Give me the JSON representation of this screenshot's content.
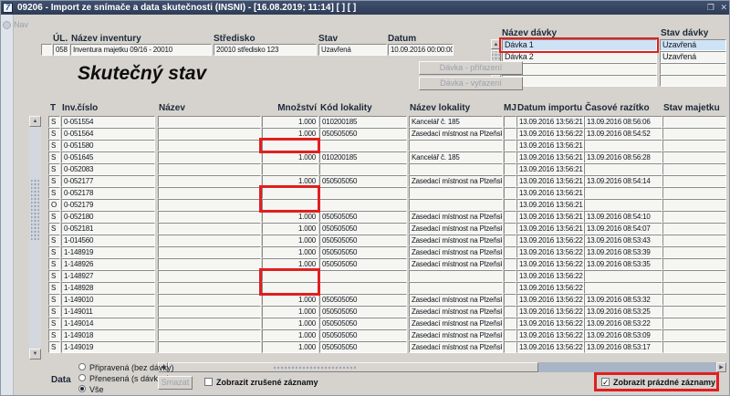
{
  "window": {
    "title": "09206 - Import ze snímače a data skutečnosti (INSNI) - [16.08.2019; 11:14]  [ ]  [ ]",
    "icon_glyph": "7",
    "controls": {
      "restore": "❐",
      "close": "✕"
    }
  },
  "nav": {
    "label": "Nav"
  },
  "header": {
    "ul_label": "ÚL.",
    "ul_value": "058",
    "nazev_label": "Název inventury",
    "nazev_value": "Inventura majetku 09/16 - 20010",
    "stredisko_label": "Středisko",
    "stredisko_value": "20010 středisko 123",
    "stav_label": "Stav",
    "stav_value": "Uzavřená",
    "datum_label": "Datum",
    "datum_value": "10.09.2016 00:00:00"
  },
  "batch_panel": {
    "name_label": "Název dávky",
    "status_label": "Stav dávky",
    "rows": [
      {
        "name": "Dávka 1",
        "status": "Uzavřená",
        "selected": true,
        "annotated": true
      },
      {
        "name": "Dávka 2",
        "status": "Uzavřená",
        "selected": false,
        "annotated": false
      },
      {
        "name": "",
        "status": "",
        "selected": false,
        "annotated": false
      },
      {
        "name": "",
        "status": "",
        "selected": false,
        "annotated": false
      }
    ]
  },
  "actions": {
    "assign": "Dávka - přiřazení",
    "remove": "Dávka - vyřazení",
    "delete": "Smazat"
  },
  "section_title": "Skutečný stav",
  "table": {
    "columns": [
      "T",
      "Inv.číslo",
      "Název",
      "Množství",
      "Kód lokality",
      "Název lokality",
      "MJ",
      "Datum importu",
      "Časové razítko",
      "Stav majetku"
    ],
    "rows": [
      {
        "t": "S",
        "inv": "0-051554",
        "nazev": "",
        "mnozstvi": "1.000",
        "kod": "010200185",
        "lokalita": "Kancelář č. 185",
        "mj": "",
        "import": "13.09.2016 13:56:21",
        "razitko": "13.09.2016 08:56:06",
        "stav": ""
      },
      {
        "t": "S",
        "inv": "0-051564",
        "nazev": "",
        "mnozstvi": "1.000",
        "kod": "050505050",
        "lokalita": "Zasedací místnost na Plzeňské",
        "mj": "",
        "import": "13.09.2016 13:56:22",
        "razitko": "13.09.2016 08:54:52",
        "stav": ""
      },
      {
        "t": "S",
        "inv": "0-051580",
        "nazev": "",
        "mnozstvi": "",
        "kod": "",
        "lokalita": "",
        "mj": "",
        "import": "13.09.2016 13:56:21",
        "razitko": "",
        "stav": ""
      },
      {
        "t": "S",
        "inv": "0-051645",
        "nazev": "",
        "mnozstvi": "1.000",
        "kod": "010200185",
        "lokalita": "Kancelář č. 185",
        "mj": "",
        "import": "13.09.2016 13:56:21",
        "razitko": "13.09.2016 08:56:28",
        "stav": ""
      },
      {
        "t": "S",
        "inv": "0-052083",
        "nazev": "",
        "mnozstvi": "",
        "kod": "",
        "lokalita": "",
        "mj": "",
        "import": "13.09.2016 13:56:21",
        "razitko": "",
        "stav": ""
      },
      {
        "t": "S",
        "inv": "0-052177",
        "nazev": "",
        "mnozstvi": "1.000",
        "kod": "050505050",
        "lokalita": "Zasedací místnost na Plzeňské",
        "mj": "",
        "import": "13.09.2016 13:56:21",
        "razitko": "13.09.2016 08:54:14",
        "stav": ""
      },
      {
        "t": "S",
        "inv": "0-052178",
        "nazev": "",
        "mnozstvi": "",
        "kod": "",
        "lokalita": "",
        "mj": "",
        "import": "13.09.2016 13:56:21",
        "razitko": "",
        "stav": ""
      },
      {
        "t": "O",
        "inv": "0-052179",
        "nazev": "",
        "mnozstvi": "",
        "kod": "",
        "lokalita": "",
        "mj": "",
        "import": "13.09.2016 13:56:21",
        "razitko": "",
        "stav": ""
      },
      {
        "t": "S",
        "inv": "0-052180",
        "nazev": "",
        "mnozstvi": "1.000",
        "kod": "050505050",
        "lokalita": "Zasedací místnost na Plzeňské",
        "mj": "",
        "import": "13.09.2016 13:56:21",
        "razitko": "13.09.2016 08:54:10",
        "stav": ""
      },
      {
        "t": "S",
        "inv": "0-052181",
        "nazev": "",
        "mnozstvi": "1.000",
        "kod": "050505050",
        "lokalita": "Zasedací místnost na Plzeňské",
        "mj": "",
        "import": "13.09.2016 13:56:21",
        "razitko": "13.09.2016 08:54:07",
        "stav": ""
      },
      {
        "t": "S",
        "inv": "1-014560",
        "nazev": "",
        "mnozstvi": "1.000",
        "kod": "050505050",
        "lokalita": "Zasedací místnost na Plzeňské",
        "mj": "",
        "import": "13.09.2016 13:56:22",
        "razitko": "13.09.2016 08:53:43",
        "stav": ""
      },
      {
        "t": "S",
        "inv": "1-148919",
        "nazev": "",
        "mnozstvi": "1.000",
        "kod": "050505050",
        "lokalita": "Zasedací místnost na Plzeňské",
        "mj": "",
        "import": "13.09.2016 13:56:22",
        "razitko": "13.09.2016 08:53:39",
        "stav": ""
      },
      {
        "t": "S",
        "inv": "1-148926",
        "nazev": "",
        "mnozstvi": "1.000",
        "kod": "050505050",
        "lokalita": "Zasedací místnost na Plzeňské",
        "mj": "",
        "import": "13.09.2016 13:56:22",
        "razitko": "13.09.2016 08:53:35",
        "stav": ""
      },
      {
        "t": "S",
        "inv": "1-148927",
        "nazev": "",
        "mnozstvi": "",
        "kod": "",
        "lokalita": "",
        "mj": "",
        "import": "13.09.2016 13:56:22",
        "razitko": "",
        "stav": ""
      },
      {
        "t": "S",
        "inv": "1-148928",
        "nazev": "",
        "mnozstvi": "",
        "kod": "",
        "lokalita": "",
        "mj": "",
        "import": "13.09.2016 13:56:22",
        "razitko": "",
        "stav": ""
      },
      {
        "t": "S",
        "inv": "1-149010",
        "nazev": "",
        "mnozstvi": "1.000",
        "kod": "050505050",
        "lokalita": "Zasedací místnost na Plzeňské",
        "mj": "",
        "import": "13.09.2016 13:56:22",
        "razitko": "13.09.2016 08:53:32",
        "stav": ""
      },
      {
        "t": "S",
        "inv": "1-149011",
        "nazev": "",
        "mnozstvi": "1.000",
        "kod": "050505050",
        "lokalita": "Zasedací místnost na Plzeňské",
        "mj": "",
        "import": "13.09.2016 13:56:22",
        "razitko": "13.09.2016 08:53:25",
        "stav": ""
      },
      {
        "t": "S",
        "inv": "1-149014",
        "nazev": "",
        "mnozstvi": "1.000",
        "kod": "050505050",
        "lokalita": "Zasedací místnost na Plzeňské",
        "mj": "",
        "import": "13.09.2016 13:56:22",
        "razitko": "13.09.2016 08:53:22",
        "stav": ""
      },
      {
        "t": "S",
        "inv": "1-149018",
        "nazev": "",
        "mnozstvi": "1.000",
        "kod": "050505050",
        "lokalita": "Zasedací místnost na Plzeňské",
        "mj": "",
        "import": "13.09.2016 13:56:22",
        "razitko": "13.09.2016 08:53:09",
        "stav": ""
      },
      {
        "t": "S",
        "inv": "1-149019",
        "nazev": "",
        "mnozstvi": "1.000",
        "kod": "050505050",
        "lokalita": "Zasedací místnost na Plzeňské",
        "mj": "",
        "import": "13.09.2016 13:56:22",
        "razitko": "13.09.2016 08:53:17",
        "stav": ""
      }
    ]
  },
  "annotations": {
    "empty_quantity_groups": [
      [
        2,
        1
      ],
      [
        6,
        2
      ],
      [
        13,
        2
      ]
    ]
  },
  "footer": {
    "data_label": "Data",
    "radios": [
      {
        "label": "Připravená (bez dávky)",
        "selected": false
      },
      {
        "label": "Přenesená (s dávkou)",
        "selected": false
      },
      {
        "label": "Vše",
        "selected": true
      }
    ],
    "cb_cancelled": {
      "label": "Zobrazit zrušené záznamy",
      "checked": false
    },
    "cb_empty": {
      "label": "Zobrazit prázdné záznamy",
      "checked": true
    }
  },
  "colors": {
    "titlebar": "#35455f",
    "selection": "#cfe3f6",
    "annotation": "#e01f1f"
  }
}
